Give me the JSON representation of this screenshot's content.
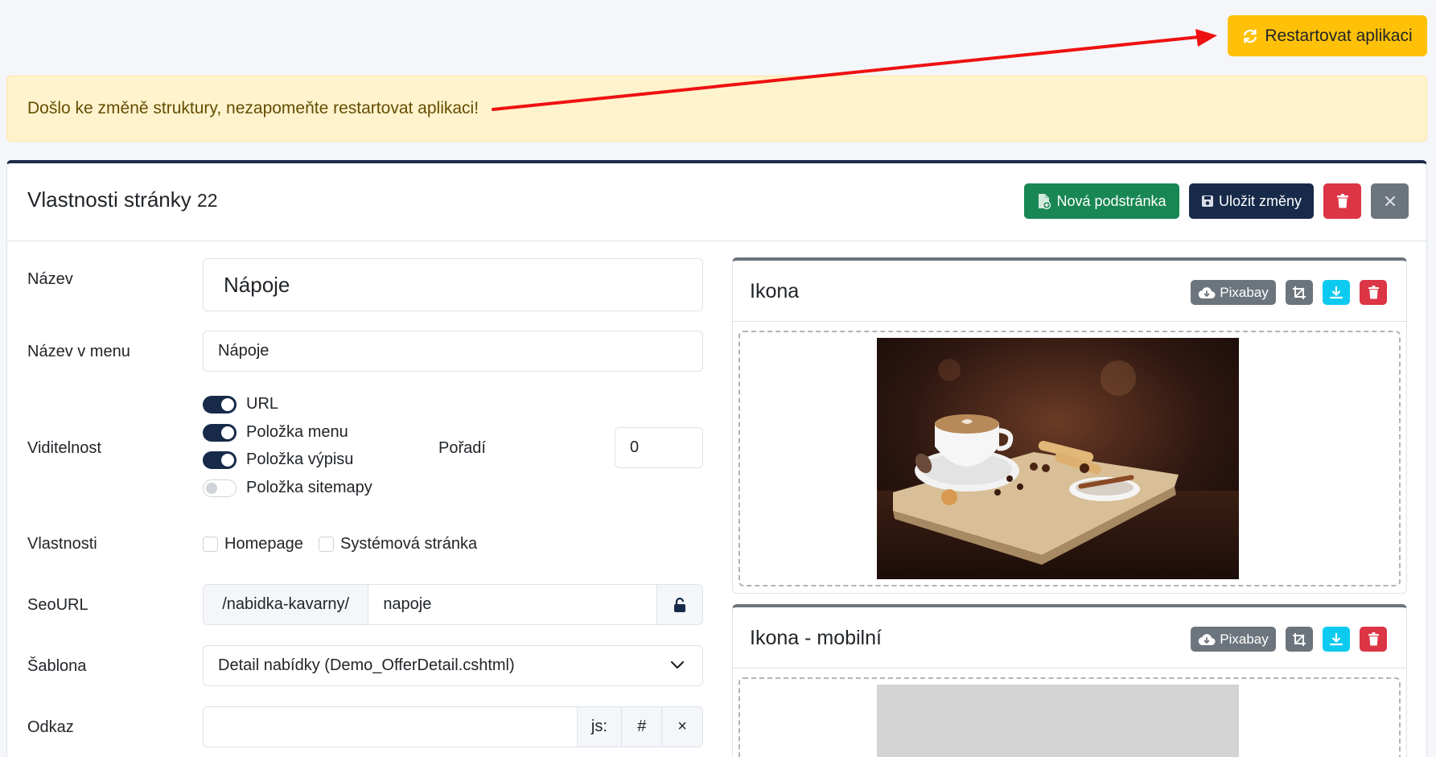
{
  "topbar": {
    "restart_label": "Restartovat aplikaci"
  },
  "alert": {
    "message": "Došlo ke změně struktury, nezapomeňte restartovat aplikaci!"
  },
  "card": {
    "title": "Vlastnosti stránky",
    "page_number": "22",
    "new_subpage_label": "Nová podstránka",
    "save_label": "Uložit změny"
  },
  "form": {
    "name_label": "Název",
    "name_value": "Nápoje",
    "menu_name_label": "Název v menu",
    "menu_name_value": "Nápoje",
    "visibility_label": "Viditelnost",
    "switches": [
      {
        "label": "URL",
        "on": true
      },
      {
        "label": "Položka menu",
        "on": true
      },
      {
        "label": "Položka výpisu",
        "on": true
      },
      {
        "label": "Položka sitemapy",
        "on": false
      }
    ],
    "order_label": "Pořadí",
    "order_value": "0",
    "properties_label": "Vlastnosti",
    "checkboxes": [
      {
        "label": "Homepage",
        "checked": false
      },
      {
        "label": "Systémová stránka",
        "checked": false
      }
    ],
    "seourl_label": "SeoURL",
    "seourl_prefix": "/nabidka-kavarny/",
    "seourl_value": "napoje",
    "template_label": "Šablona",
    "template_value": "Detail nabídky (Demo_OfferDetail.cshtml)",
    "link_label": "Odkaz",
    "link_value": "",
    "link_addons": [
      "js:",
      "#",
      "×"
    ]
  },
  "icon_panel": {
    "title": "Ikona",
    "pixabay_label": "Pixabay"
  },
  "icon_mobile_panel": {
    "title": "Ikona - mobilní",
    "pixabay_label": "Pixabay"
  },
  "colors": {
    "warning": "#ffc107",
    "success": "#198754",
    "navy": "#172a4a",
    "danger": "#dc3545",
    "secondary": "#6c757d",
    "info": "#0dcaf0"
  }
}
